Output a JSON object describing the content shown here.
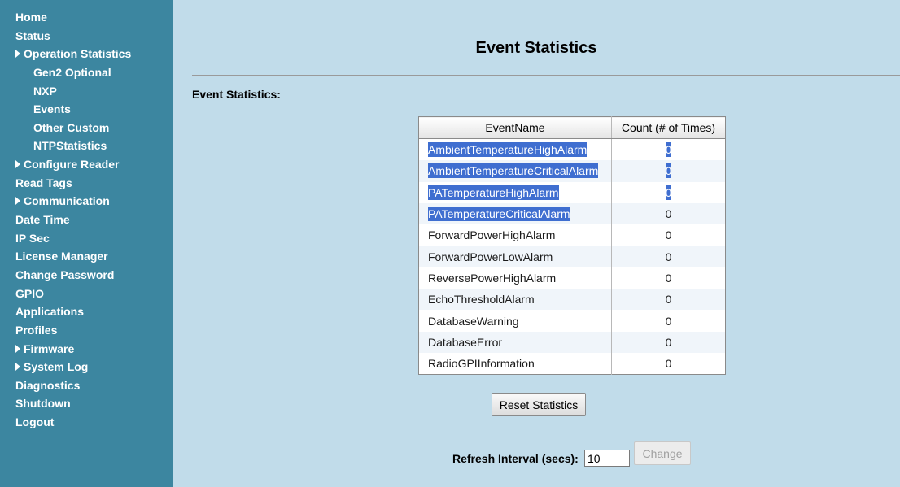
{
  "sidebar": {
    "items": [
      {
        "label": "Home",
        "sub": false,
        "arrow": false
      },
      {
        "label": "Status",
        "sub": false,
        "arrow": false
      },
      {
        "label": "Operation Statistics",
        "sub": false,
        "arrow": true
      },
      {
        "label": "Gen2 Optional",
        "sub": true,
        "arrow": false
      },
      {
        "label": "NXP",
        "sub": true,
        "arrow": false
      },
      {
        "label": "Events",
        "sub": true,
        "arrow": false
      },
      {
        "label": "Other Custom",
        "sub": true,
        "arrow": false
      },
      {
        "label": "NTPStatistics",
        "sub": true,
        "arrow": false
      },
      {
        "label": "Configure Reader",
        "sub": false,
        "arrow": true
      },
      {
        "label": "Read Tags",
        "sub": false,
        "arrow": false
      },
      {
        "label": "Communication",
        "sub": false,
        "arrow": true
      },
      {
        "label": "Date Time",
        "sub": false,
        "arrow": false
      },
      {
        "label": "IP Sec",
        "sub": false,
        "arrow": false
      },
      {
        "label": "License Manager",
        "sub": false,
        "arrow": false
      },
      {
        "label": "Change Password",
        "sub": false,
        "arrow": false
      },
      {
        "label": "GPIO",
        "sub": false,
        "arrow": false
      },
      {
        "label": "Applications",
        "sub": false,
        "arrow": false
      },
      {
        "label": "Profiles",
        "sub": false,
        "arrow": false
      },
      {
        "label": "Firmware",
        "sub": false,
        "arrow": true
      },
      {
        "label": "System Log",
        "sub": false,
        "arrow": true
      },
      {
        "label": "Diagnostics",
        "sub": false,
        "arrow": false
      },
      {
        "label": "Shutdown",
        "sub": false,
        "arrow": false
      },
      {
        "label": "Logout",
        "sub": false,
        "arrow": false
      }
    ]
  },
  "main": {
    "title": "Event Statistics",
    "section_label": "Event Statistics:",
    "table": {
      "headers": [
        "EventName",
        "Count (# of Times)"
      ],
      "rows": [
        {
          "name": "AmbientTemperatureHighAlarm",
          "count": "0",
          "name_selected": true,
          "count_selected": true
        },
        {
          "name": "AmbientTemperatureCriticalAlarm",
          "count": "0",
          "name_selected": true,
          "count_selected": true
        },
        {
          "name": "PATemperatureHighAlarm",
          "count": "0",
          "name_selected": true,
          "count_selected": true
        },
        {
          "name": "PATemperatureCriticalAlarm",
          "count": "0",
          "name_selected": true,
          "count_selected": false
        },
        {
          "name": "ForwardPowerHighAlarm",
          "count": "0",
          "name_selected": false,
          "count_selected": false
        },
        {
          "name": "ForwardPowerLowAlarm",
          "count": "0",
          "name_selected": false,
          "count_selected": false
        },
        {
          "name": "ReversePowerHighAlarm",
          "count": "0",
          "name_selected": false,
          "count_selected": false
        },
        {
          "name": "EchoThresholdAlarm",
          "count": "0",
          "name_selected": false,
          "count_selected": false
        },
        {
          "name": "DatabaseWarning",
          "count": "0",
          "name_selected": false,
          "count_selected": false
        },
        {
          "name": "DatabaseError",
          "count": "0",
          "name_selected": false,
          "count_selected": false
        },
        {
          "name": "RadioGPIInformation",
          "count": "0",
          "name_selected": false,
          "count_selected": false
        }
      ]
    },
    "reset_button": "Reset Statistics",
    "refresh_label": "Refresh Interval (secs):",
    "refresh_value": "10",
    "change_button": "Change"
  },
  "colors": {
    "sidebar_bg": "#3c86a0",
    "page_bg": "#c1dcea",
    "selection": "#3f6ed0"
  }
}
